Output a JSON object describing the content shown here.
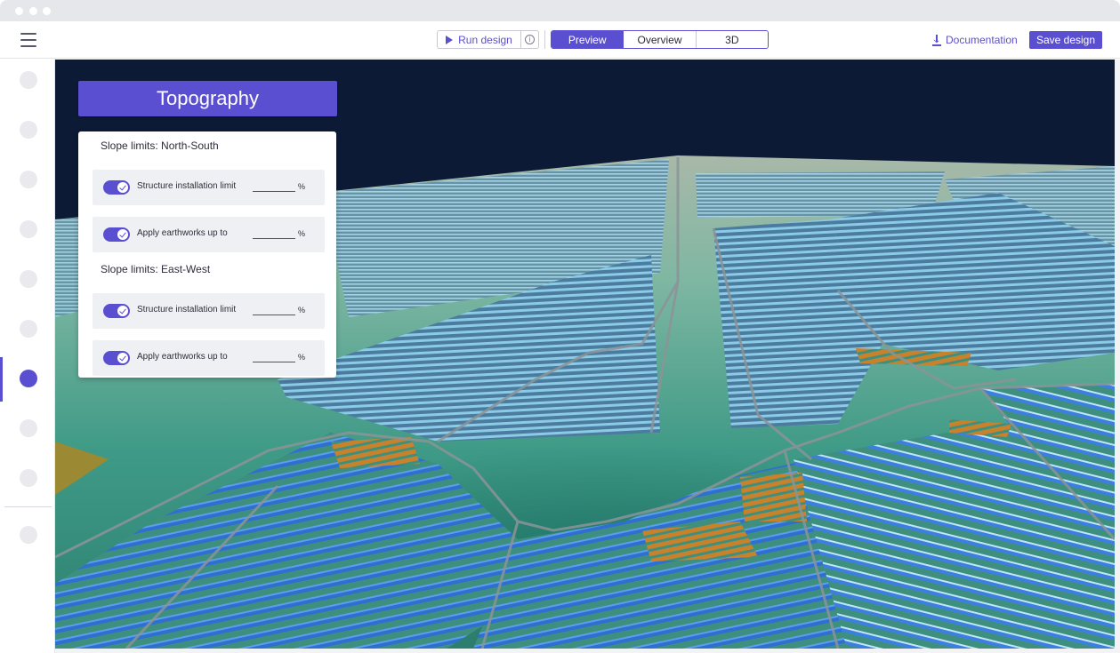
{
  "toolbar": {
    "run_label": "Run design",
    "tabs": [
      {
        "label": "Preview",
        "active": true
      },
      {
        "label": "Overview",
        "active": false
      },
      {
        "label": "3D",
        "active": false
      }
    ],
    "documentation_label": "Documentation",
    "save_label": "Save design",
    "accent_color": "#5b4fd1"
  },
  "sidebar": {
    "items": [
      {
        "name": "step-1",
        "active": false
      },
      {
        "name": "step-2",
        "active": false
      },
      {
        "name": "step-3",
        "active": false
      },
      {
        "name": "step-4",
        "active": false
      },
      {
        "name": "step-5",
        "active": false
      },
      {
        "name": "step-6",
        "active": false
      },
      {
        "name": "step-7",
        "active": true
      },
      {
        "name": "step-8",
        "active": false
      },
      {
        "name": "step-9",
        "active": false
      },
      {
        "name": "step-10",
        "active": false
      }
    ]
  },
  "panel": {
    "title": "Topography",
    "sections": [
      {
        "title": "Slope limits: North-South",
        "rows": [
          {
            "label": "Structure installation limit",
            "value": "",
            "unit": "%",
            "enabled": true
          },
          {
            "label": "Apply earthworks up to",
            "value": "",
            "unit": "%",
            "enabled": true
          }
        ]
      },
      {
        "title": "Slope limits: East-West",
        "rows": [
          {
            "label": "Structure installation limit",
            "value": "",
            "unit": "%",
            "enabled": true
          },
          {
            "label": "Apply earthworks up to",
            "value": "",
            "unit": "%",
            "enabled": true
          }
        ]
      }
    ]
  },
  "scene": {
    "sky_color": "#0c1a36",
    "terrain_color": "#3e9a86",
    "panel_color": "#4a8fd8",
    "highlight_color": "#c8822c"
  }
}
